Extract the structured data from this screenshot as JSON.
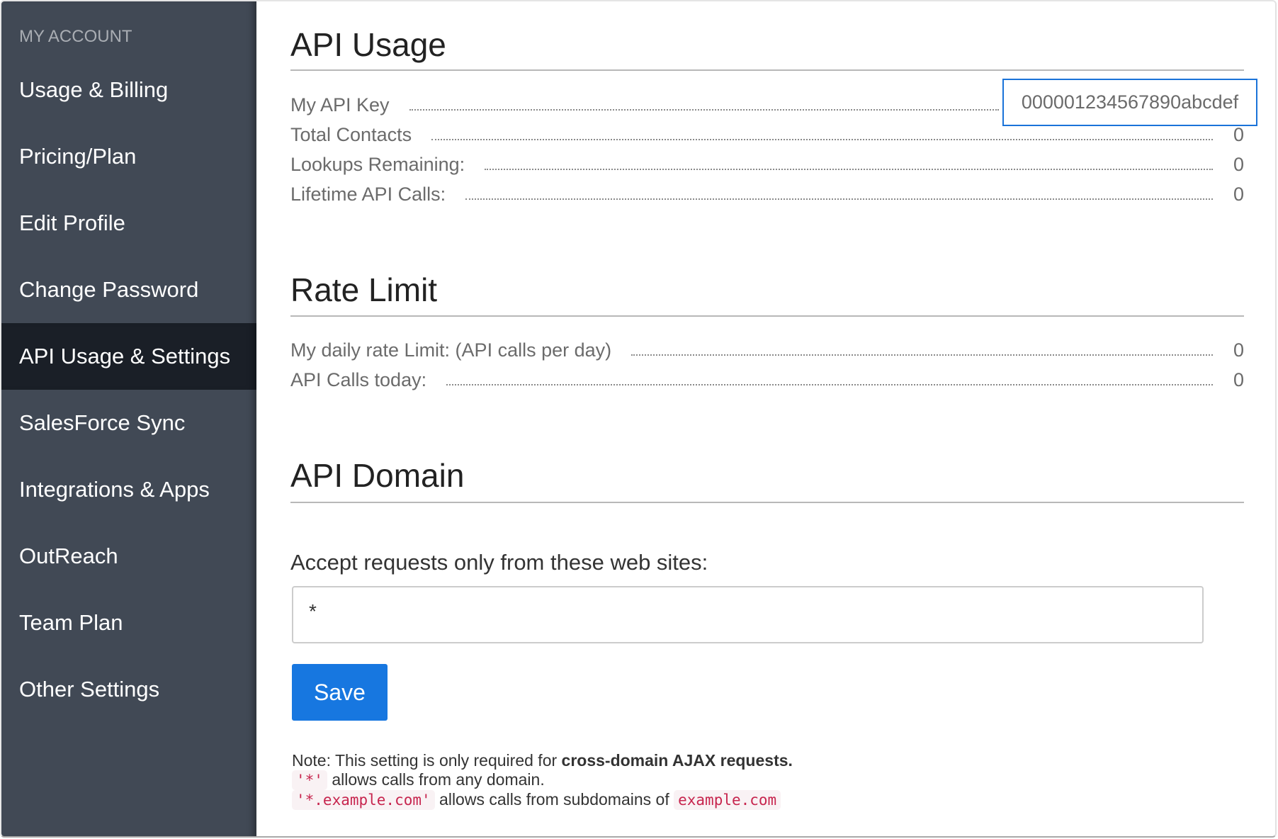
{
  "sidebar": {
    "heading": "MY ACCOUNT",
    "items": [
      {
        "label": "Usage & Billing",
        "active": false
      },
      {
        "label": "Pricing/Plan",
        "active": false
      },
      {
        "label": "Edit Profile",
        "active": false
      },
      {
        "label": "Change Password",
        "active": false
      },
      {
        "label": "API Usage & Settings",
        "active": true
      },
      {
        "label": "SalesForce Sync",
        "active": false
      },
      {
        "label": "Integrations & Apps",
        "active": false
      },
      {
        "label": "OutReach",
        "active": false
      },
      {
        "label": "Team Plan",
        "active": false
      },
      {
        "label": "Other Settings",
        "active": false
      }
    ]
  },
  "api_usage": {
    "title": "API Usage",
    "api_key_label": "My API Key",
    "api_key_value": "000001234567890abcdef",
    "rows": [
      {
        "label": "Total Contacts",
        "value": "0"
      },
      {
        "label": "Lookups Remaining:",
        "value": "0"
      },
      {
        "label": "Lifetime API Calls:",
        "value": "0"
      }
    ]
  },
  "rate_limit": {
    "title": "Rate Limit",
    "rows": [
      {
        "label": "My daily rate Limit: (API calls per day)",
        "value": "0"
      },
      {
        "label": "API Calls today:",
        "value": "0"
      }
    ]
  },
  "api_domain": {
    "title": "API Domain",
    "field_label": "Accept requests only from these web sites:",
    "field_value": "*",
    "save_label": "Save",
    "note": {
      "prefix": "Note: This setting is only required for ",
      "bold": "cross-domain AJAX requests.",
      "line2_code": "'*'",
      "line2_text": " allows calls from any domain.",
      "line3_code": "'*.example.com'",
      "line3_text": " allows calls from subdomains of ",
      "line3_code2": "example.com"
    }
  },
  "colors": {
    "sidebar_bg": "#414955",
    "sidebar_active_bg": "#1a1f27",
    "accent": "#1777e0",
    "code_text": "#c7254e"
  }
}
